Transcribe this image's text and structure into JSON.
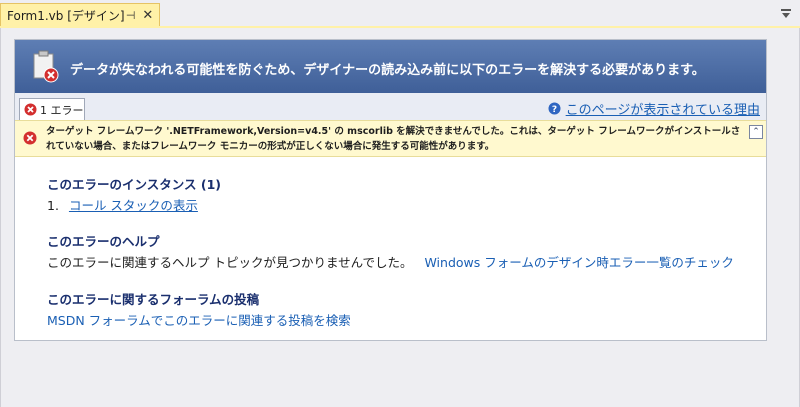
{
  "tab": {
    "title": "Form1.vb [デザイン]",
    "pin_glyph": "⊣",
    "close_glyph": "✕"
  },
  "banner": {
    "message": "データが失なわれる可能性を防ぐため、デザイナーの読み込み前に以下のエラーを解決する必要があります。"
  },
  "error_tab": {
    "label": "1 エラー"
  },
  "reason_link": {
    "label": "このページが表示されている理由"
  },
  "error": {
    "text": "ターゲット フレームワーク '.NETFramework,Version=v4.5' の mscorlib を解決できませんでした。これは、ターゲット フレームワークがインストールされていない場合、またはフレームワーク モニカーの形式が正しくない場合に発生する可能性があります。",
    "collapse_glyph": "⌃"
  },
  "sections": {
    "instances": {
      "title": "このエラーのインスタンス (1)",
      "item_number": "1.",
      "item_link": "コール スタックの表示"
    },
    "help": {
      "title": "このエラーのヘルプ",
      "text": "このエラーに関連するヘルプ トピックが見つかりませんでした。",
      "link": "Windows フォームのデザイン時エラー一覧のチェック"
    },
    "forum": {
      "title": "このエラーに関するフォーラムの投稿",
      "link": "MSDN フォーラムでこのエラーに関連する投稿を検索"
    }
  },
  "colors": {
    "banner_top": "#5e7eb4",
    "banner_bottom": "#3f5f98",
    "active_tab": "#fff1a8",
    "error_box": "#fff9cf",
    "link": "#1a5fb4",
    "section_title": "#1a2f6e",
    "error_red": "#d32f2f"
  }
}
